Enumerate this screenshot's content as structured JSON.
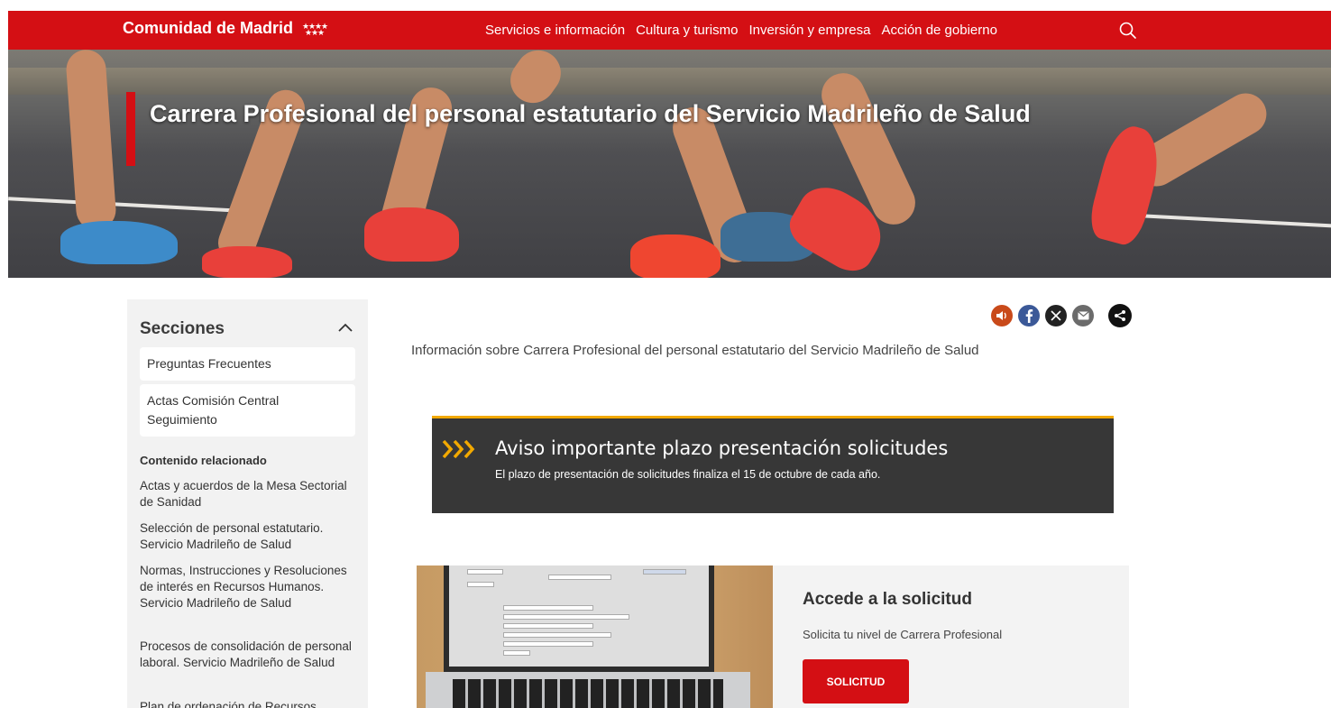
{
  "header": {
    "brand": "Comunidad de Madrid",
    "nav": [
      "Servicios e información",
      "Cultura y turismo",
      "Inversión y empresa",
      "Acción de gobierno"
    ],
    "search_icon": "search-icon"
  },
  "hero": {
    "title": "Carrera Profesional del personal estatutario del Servicio Madrileño de Salud"
  },
  "sidebar": {
    "heading": "Secciones",
    "sections": [
      "Preguntas Frecuentes",
      "Actas Comisión Central Seguimiento"
    ],
    "related_heading": "Contenido relacionado",
    "related": [
      "Actas y acuerdos de la Mesa Sectorial de Sanidad",
      "Selección de personal estatutario. Servicio Madrileño de Salud",
      "Normas, Instrucciones y Resoluciones de interés en Recursos Humanos. Servicio Madrileño de Salud",
      "Procesos de consolidación de personal laboral. Servicio Madrileño de Salud",
      "Plan de ordenación de Recursos"
    ]
  },
  "share": {
    "icons": [
      "audio-icon",
      "facebook-icon",
      "x-icon",
      "email-icon",
      "share-icon"
    ],
    "colors": {
      "audio": "#c94a1a",
      "facebook": "#3b5998",
      "x": "#222222",
      "email": "#6b6b6b",
      "share": "#111111"
    }
  },
  "main": {
    "intro": "Información sobre Carrera Profesional del personal estatutario del Servicio Madrileño de Salud",
    "notice": {
      "title": "Aviso importante plazo presentación solicitudes",
      "text": "El plazo de presentación de solicitudes finaliza el 15 de octubre de cada año."
    },
    "card": {
      "title": "Accede a la solicitud",
      "text": "Solicita tu nivel de Carrera Profesional",
      "button": "SOLICITUD"
    }
  },
  "colors": {
    "brand_red": "#d40f14",
    "notice_bg": "#373737",
    "notice_accent": "#f2a900"
  }
}
